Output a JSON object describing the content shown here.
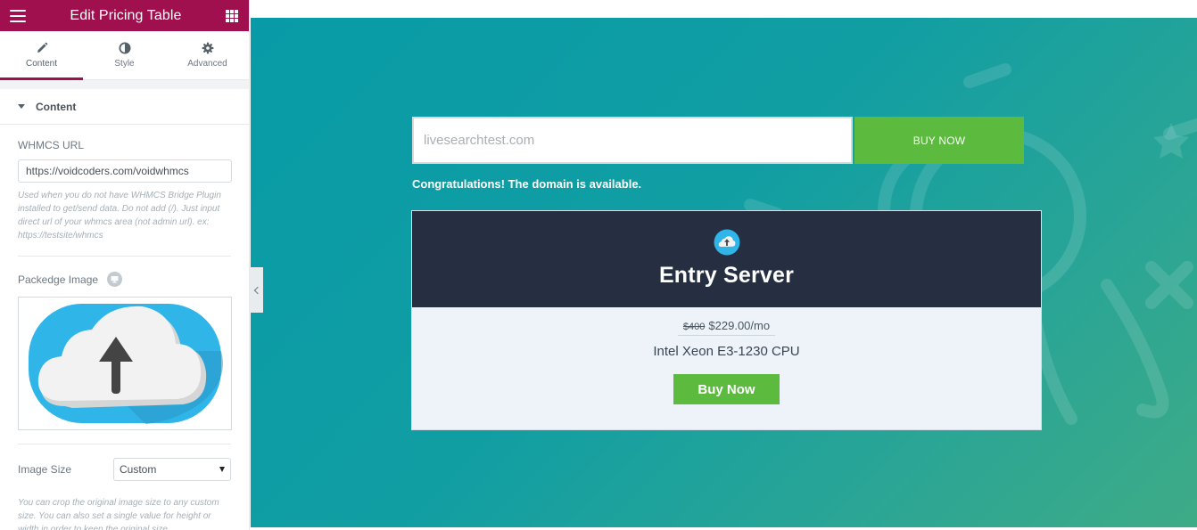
{
  "panel": {
    "title": "Edit Pricing Table",
    "tabs": [
      {
        "label": "Content",
        "icon": "pencil-icon",
        "active": true
      },
      {
        "label": "Style",
        "icon": "half-circle-icon",
        "active": false
      },
      {
        "label": "Advanced",
        "icon": "gear-icon",
        "active": false
      }
    ],
    "section_title": "Content",
    "whmcs_url": {
      "label": "WHMCS URL",
      "value": "https://voidcoders.com/voidwhmcs",
      "description": "Used when you do not have WHMCS Bridge Plugin installed to get/send data. Do not add (/). Just input direct url of your whmcs area (not admin url). ex: https://testsite/whmcs"
    },
    "package_image": {
      "label": "Packedge Image",
      "icon": "monitor-icon"
    },
    "image_size": {
      "label": "Image Size",
      "selected": "Custom",
      "description": "You can crop the original image size to any custom size. You can also set a single value for height or width in order to keep the original size"
    },
    "colors": {
      "header": "#a0104f"
    }
  },
  "preview": {
    "domain_input_value": "livesearchtest.com",
    "search_button": "BUY NOW",
    "availability_message": "Congratulations! The domain is available.",
    "card": {
      "icon": "cloud-upload-icon",
      "title": "Entry Server",
      "old_price": "$400",
      "price": "$229.00/mo",
      "feature": "Intel Xeon E3-1230 CPU",
      "button": "Buy Now"
    },
    "colors": {
      "button": "#5cba3e",
      "card_header": "#252f41",
      "card_body": "#edf3f9"
    }
  }
}
